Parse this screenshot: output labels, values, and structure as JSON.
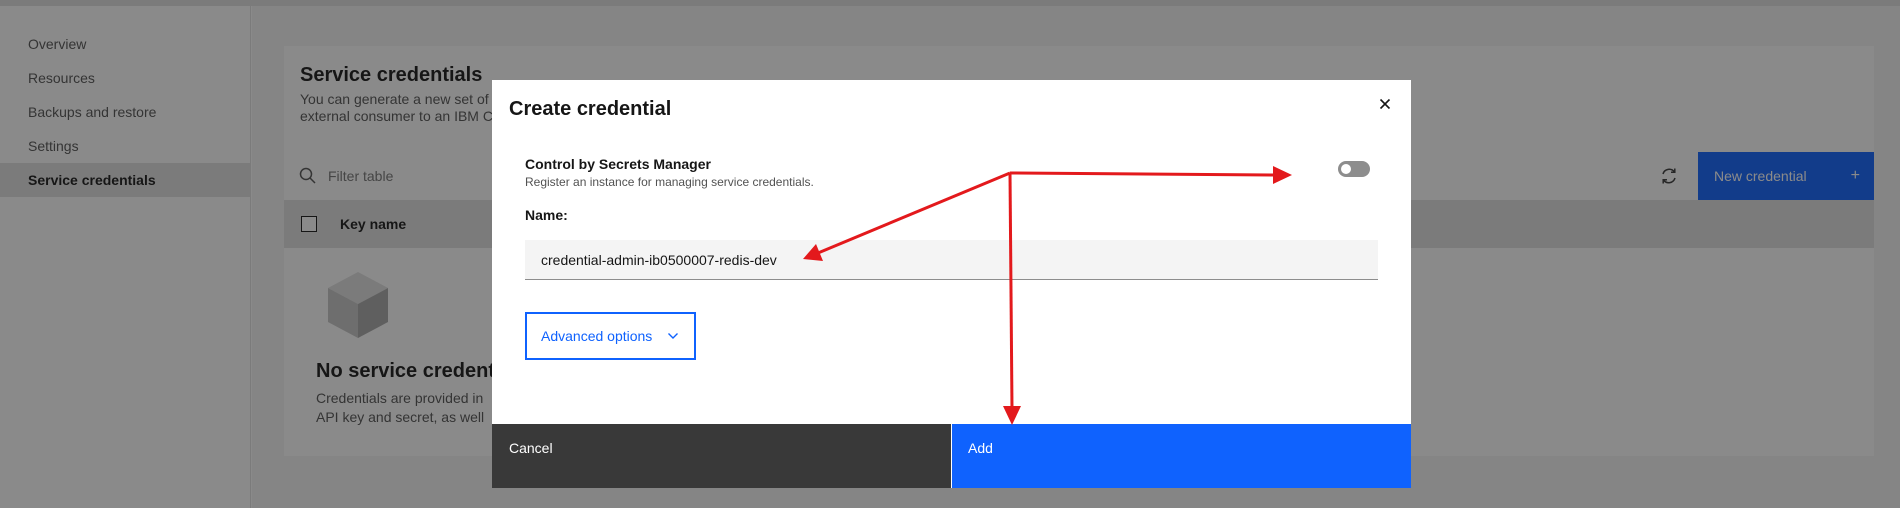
{
  "sidebar": {
    "items": [
      {
        "label": "Overview"
      },
      {
        "label": "Resources"
      },
      {
        "label": "Backups and restore"
      },
      {
        "label": "Settings"
      },
      {
        "label": "Service credentials"
      }
    ]
  },
  "page": {
    "title": "Service credentials",
    "description": "You can generate a new set of\nexternal consumer to an IBM C",
    "filter_placeholder": "Filter table",
    "new_credential_label": "New credential",
    "new_credential_icon": "+",
    "table": {
      "columns": [
        "Key name"
      ]
    },
    "empty_state": {
      "title": "No service credentia",
      "description": "Credentials are provided in\nAPI key and secret, as well"
    }
  },
  "modal": {
    "title": "Create credential",
    "close_icon": "close-icon",
    "secrets_manager": {
      "title": "Control by Secrets Manager",
      "help": "Register an instance for managing service credentials.",
      "enabled": false
    },
    "name_label": "Name:",
    "name_value": "credential-admin-ib0500007-redis-dev",
    "advanced_options_label": "Advanced options",
    "cancel_label": "Cancel",
    "add_label": "Add"
  },
  "colors": {
    "primary": "#0f62fe",
    "secondary_button": "#393939",
    "annotation_arrow": "#e3191c"
  }
}
